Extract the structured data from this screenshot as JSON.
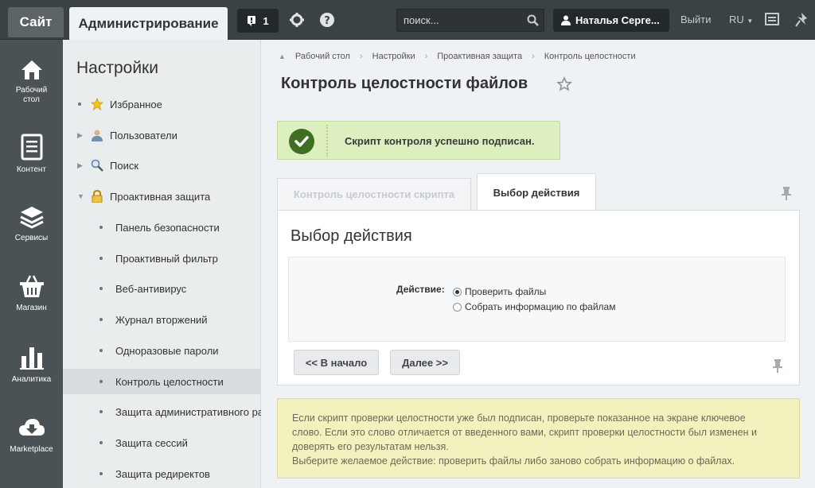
{
  "topbar": {
    "site_label": "Сайт",
    "admin_label": "Администрирование",
    "notifications_count": "1",
    "search_placeholder": "поиск...",
    "user_name": "Наталья Серге...",
    "logout_label": "Выйти",
    "language": "RU"
  },
  "leftnav": {
    "items": [
      {
        "label_line1": "Рабочий",
        "label_line2": "стол",
        "icon": "home-icon"
      },
      {
        "label_line1": "Контент",
        "label_line2": "",
        "icon": "document-icon"
      },
      {
        "label_line1": "Сервисы",
        "label_line2": "",
        "icon": "layers-icon"
      },
      {
        "label_line1": "Магазин",
        "label_line2": "",
        "icon": "basket-icon"
      },
      {
        "label_line1": "Аналитика",
        "label_line2": "",
        "icon": "bar-chart-icon"
      },
      {
        "label_line1": "Marketplace",
        "label_line2": "",
        "icon": "cloud-download-icon"
      }
    ]
  },
  "settings": {
    "title": "Настройки",
    "items": [
      {
        "label": "Избранное",
        "icon": "star-icon"
      },
      {
        "label": "Пользователи",
        "icon": "user-icon"
      },
      {
        "label": "Поиск",
        "icon": "magnifier-icon"
      },
      {
        "label": "Проактивная защита",
        "icon": "lock-icon"
      },
      {
        "label": "Панель безопасности"
      },
      {
        "label": "Проактивный фильтр"
      },
      {
        "label": "Веб-антивирус"
      },
      {
        "label": "Журнал вторжений"
      },
      {
        "label": "Одноразовые пароли"
      },
      {
        "label": "Контроль целостности"
      },
      {
        "label": "Защита административного раздела"
      },
      {
        "label": "Защита сессий"
      },
      {
        "label": "Защита редиректов"
      }
    ]
  },
  "breadcrumb": [
    "Рабочий стол",
    "Настройки",
    "Проактивная защита",
    "Контроль целостности"
  ],
  "page": {
    "title": "Контроль целостности файлов",
    "success_message": "Скрипт контроля успешно подписан.",
    "tabs": [
      "Контроль целостности скрипта",
      "Выбор действия"
    ],
    "panel_title": "Выбор действия",
    "action_label": "Действие:",
    "options": [
      "Проверить файлы",
      "Собрать информацию по файлам"
    ],
    "btn_back": "<< В начало",
    "btn_next": "Далее >>",
    "note_lines": [
      "Если скрипт проверки целостности уже был подписан, проверьте показанное на экране ключевое",
      "слово. Если это слово отличается от введенного вами, скрипт проверки целостности был изменен и",
      "доверять его результатам нельзя.",
      "Выберите желаемое действие: проверить файлы либо заново собрать информацию о файлах."
    ]
  }
}
